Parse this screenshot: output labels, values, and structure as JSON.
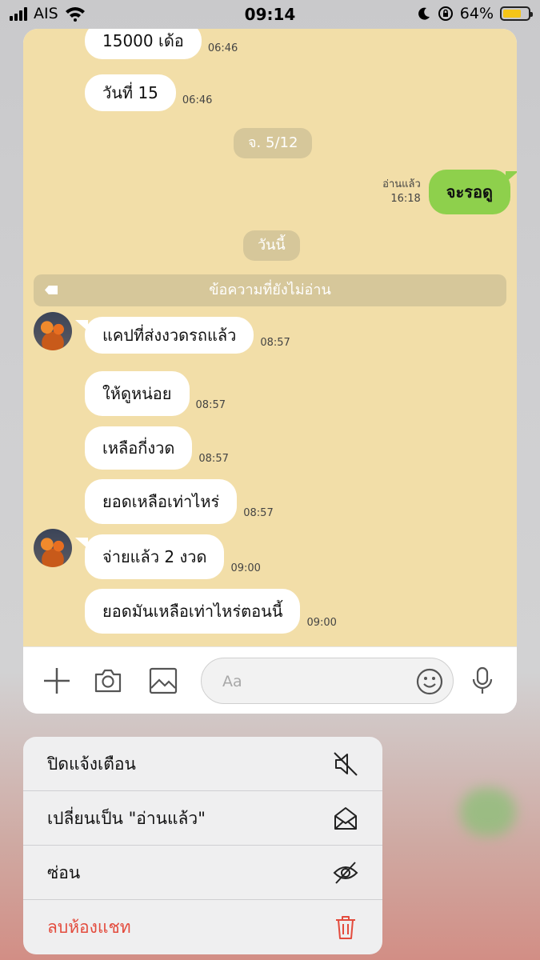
{
  "status_bar": {
    "carrier": "AIS",
    "time": "09:14",
    "battery_percent": "64%",
    "battery_level": 0.64
  },
  "chat": {
    "messages": [
      {
        "text": "15000 เด้อ",
        "time": "06:46"
      },
      {
        "text": "วันที่ 15",
        "time": "06:46"
      },
      {
        "text": "แคปที่ส่งงวดรถแล้ว",
        "time": "08:57"
      },
      {
        "text": "ให้ดูหน่อย",
        "time": "08:57"
      },
      {
        "text": "เหลือกี่งวด",
        "time": "08:57"
      },
      {
        "text": "ยอดเหลือเท่าไหร่",
        "time": "08:57"
      },
      {
        "text": "จ่ายแล้ว 2 งวด",
        "time": "09:00"
      },
      {
        "text": "ยอดมันเหลือเท่าไหร่ตอนนี้",
        "time": "09:00"
      }
    ],
    "date_separators": [
      "จ. 5/12",
      "วันนี้"
    ],
    "sent_message": {
      "text": "จะรอดู",
      "status": "อ่านแล้ว",
      "time": "16:18"
    },
    "unread_label": "ข้อความที่ยังไม่อ่าน"
  },
  "input_bar": {
    "placeholder": "Aa",
    "icons": [
      "plus-icon",
      "camera-icon",
      "image-icon",
      "emoji-icon",
      "microphone-icon"
    ]
  },
  "context_menu": {
    "items": [
      {
        "label": "ปิดแจ้งเตือน",
        "icon": "mute-icon"
      },
      {
        "label": "เปลี่ยนเป็น \"อ่านแล้ว\"",
        "icon": "open-envelope-icon"
      },
      {
        "label": "ซ่อน",
        "icon": "eye-slash-icon"
      },
      {
        "label": "ลบห้องแชท",
        "icon": "trash-icon",
        "color": "#e34b3d"
      }
    ]
  },
  "colors": {
    "chat_background": "#f2dea8",
    "sent_bubble": "#8ed04c",
    "danger": "#e34b3d"
  }
}
